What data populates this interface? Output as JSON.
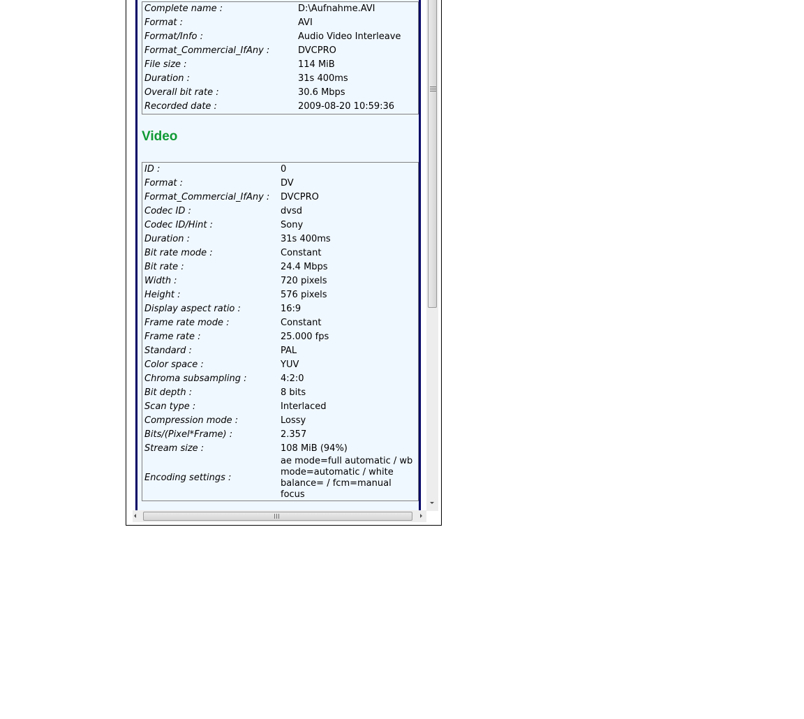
{
  "general": {
    "rows": [
      {
        "key": "Complete name :",
        "value": "D:\\Aufnahme.AVI"
      },
      {
        "key": "Format :",
        "value": "AVI"
      },
      {
        "key": "Format/Info :",
        "value": "Audio Video Interleave"
      },
      {
        "key": "Format_Commercial_IfAny :",
        "value": "DVCPRO"
      },
      {
        "key": "File size :",
        "value": "114 MiB"
      },
      {
        "key": "Duration :",
        "value": "31s 400ms"
      },
      {
        "key": "Overall bit rate :",
        "value": "30.6 Mbps"
      },
      {
        "key": "Recorded date :",
        "value": "2009-08-20 10:59:36"
      }
    ]
  },
  "video": {
    "title": "Video",
    "rows": [
      {
        "key": "ID :",
        "value": "0"
      },
      {
        "key": "Format :",
        "value": "DV"
      },
      {
        "key": "Format_Commercial_IfAny :",
        "value": "DVCPRO"
      },
      {
        "key": "Codec ID :",
        "value": "dvsd"
      },
      {
        "key": "Codec ID/Hint :",
        "value": "Sony"
      },
      {
        "key": "Duration :",
        "value": "31s 400ms"
      },
      {
        "key": "Bit rate mode :",
        "value": "Constant"
      },
      {
        "key": "Bit rate :",
        "value": "24.4 Mbps"
      },
      {
        "key": "Width :",
        "value": "720 pixels"
      },
      {
        "key": "Height :",
        "value": "576 pixels"
      },
      {
        "key": "Display aspect ratio :",
        "value": "16:9"
      },
      {
        "key": "Frame rate mode :",
        "value": "Constant"
      },
      {
        "key": "Frame rate :",
        "value": "25.000 fps"
      },
      {
        "key": "Standard :",
        "value": "PAL"
      },
      {
        "key": "Color space :",
        "value": "YUV"
      },
      {
        "key": "Chroma subsampling :",
        "value": "4:2:0"
      },
      {
        "key": "Bit depth :",
        "value": "8 bits"
      },
      {
        "key": "Scan type :",
        "value": "Interlaced"
      },
      {
        "key": "Compression mode :",
        "value": "Lossy"
      },
      {
        "key": "Bits/(Pixel*Frame) :",
        "value": "2.357"
      },
      {
        "key": "Stream size :",
        "value": "108 MiB (94%)"
      },
      {
        "key": "Encoding settings :",
        "value": "ae mode=full automatic / wb mode=automatic / white balance= / fcm=manual focus"
      }
    ]
  },
  "scrollbars": {
    "vertical_position": 0.0,
    "horizontal_position": 0.0
  }
}
